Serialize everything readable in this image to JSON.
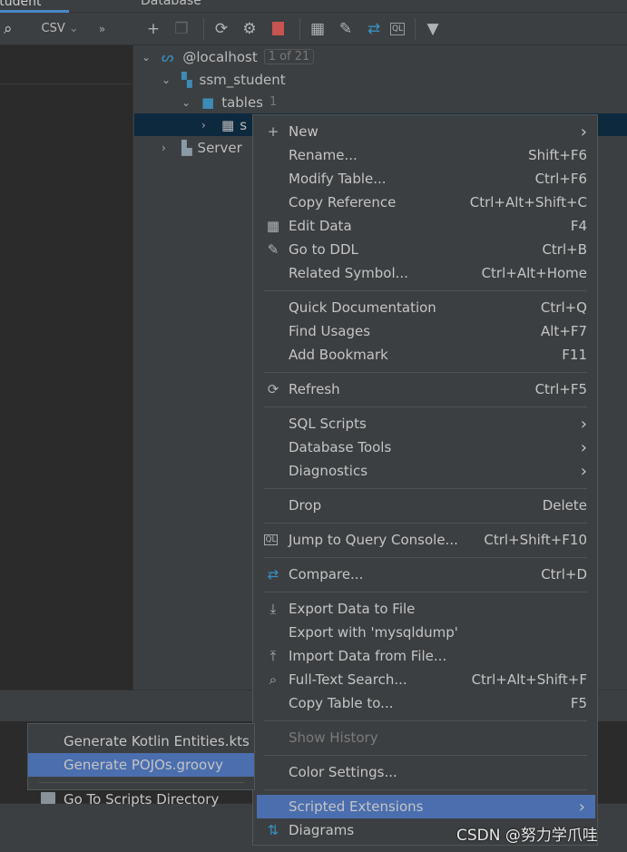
{
  "top": {
    "tab_label": "student",
    "panel_title": "Database"
  },
  "left_toolbar": {
    "format": "CSV",
    "more": "»"
  },
  "toolbar_icons": [
    "add-icon",
    "duplicate-icon",
    "refresh-icon",
    "schema-tools-icon",
    "stop-icon",
    "table-icon",
    "edit-icon",
    "compare-icon",
    "query-console-icon",
    "filter-icon"
  ],
  "tree": {
    "host": "@localhost",
    "host_badge": "1 of 21",
    "schema": "ssm_student",
    "tables": "tables",
    "tables_count": "1",
    "table": "s",
    "server": "Server"
  },
  "menu": [
    {
      "type": "item",
      "icon": "+",
      "label": "New",
      "submenu": true
    },
    {
      "type": "item",
      "label": "Rename...",
      "shortcut": "Shift+F6"
    },
    {
      "type": "item",
      "label": "Modify Table...",
      "shortcut": "Ctrl+F6"
    },
    {
      "type": "item",
      "label": "Copy Reference",
      "shortcut": "Ctrl+Alt+Shift+C"
    },
    {
      "type": "item",
      "icon": "▦",
      "label": "Edit Data",
      "shortcut": "F4"
    },
    {
      "type": "item",
      "icon": "✎",
      "label": "Go to DDL",
      "shortcut": "Ctrl+B"
    },
    {
      "type": "item",
      "label": "Related Symbol...",
      "shortcut": "Ctrl+Alt+Home"
    },
    {
      "type": "sep"
    },
    {
      "type": "item",
      "label": "Quick Documentation",
      "shortcut": "Ctrl+Q"
    },
    {
      "type": "item",
      "label": "Find Usages",
      "shortcut": "Alt+F7"
    },
    {
      "type": "item",
      "label": "Add Bookmark",
      "shortcut": "F11"
    },
    {
      "type": "sep"
    },
    {
      "type": "item",
      "icon": "⟳",
      "label": "Refresh",
      "shortcut": "Ctrl+F5"
    },
    {
      "type": "sep"
    },
    {
      "type": "item",
      "label": "SQL Scripts",
      "submenu": true
    },
    {
      "type": "item",
      "label": "Database Tools",
      "submenu": true
    },
    {
      "type": "item",
      "label": "Diagnostics",
      "submenu": true
    },
    {
      "type": "sep"
    },
    {
      "type": "item",
      "label": "Drop",
      "shortcut": "Delete"
    },
    {
      "type": "sep"
    },
    {
      "type": "item",
      "icon": "QL",
      "label": "Jump to Query Console...",
      "shortcut": "Ctrl+Shift+F10"
    },
    {
      "type": "sep"
    },
    {
      "type": "item",
      "icon": "⇄",
      "label": "Compare...",
      "shortcut": "Ctrl+D"
    },
    {
      "type": "sep"
    },
    {
      "type": "item",
      "icon": "⤓",
      "label": "Export Data to File"
    },
    {
      "type": "item",
      "label": "Export with 'mysqldump'"
    },
    {
      "type": "item",
      "icon": "⤒",
      "label": "Import Data from File..."
    },
    {
      "type": "item",
      "icon": "⌕",
      "label": "Full-Text Search...",
      "shortcut": "Ctrl+Alt+Shift+F"
    },
    {
      "type": "item",
      "label": "Copy Table to...",
      "shortcut": "F5"
    },
    {
      "type": "sep"
    },
    {
      "type": "item",
      "label": "Show History",
      "disabled": true
    },
    {
      "type": "sep"
    },
    {
      "type": "item",
      "label": "Color Settings..."
    },
    {
      "type": "sep"
    },
    {
      "type": "item",
      "label": "Scripted Extensions",
      "submenu": true,
      "highlighted": true
    },
    {
      "type": "item",
      "icon": "⇅",
      "label": "Diagrams"
    }
  ],
  "submenu": [
    {
      "type": "item",
      "label": "Generate Kotlin Entities.kts"
    },
    {
      "type": "item",
      "label": "Generate POJOs.groovy",
      "highlighted": true
    },
    {
      "type": "sep"
    },
    {
      "type": "item",
      "icon": "folder",
      "label": "Go To Scripts Directory"
    }
  ],
  "watermark": "CSDN @努力学爪哇",
  "colors": {
    "highlight": "#4b6eaf",
    "selection": "#0d293e",
    "stop": "#c75450",
    "accent": "#4a88c7"
  }
}
